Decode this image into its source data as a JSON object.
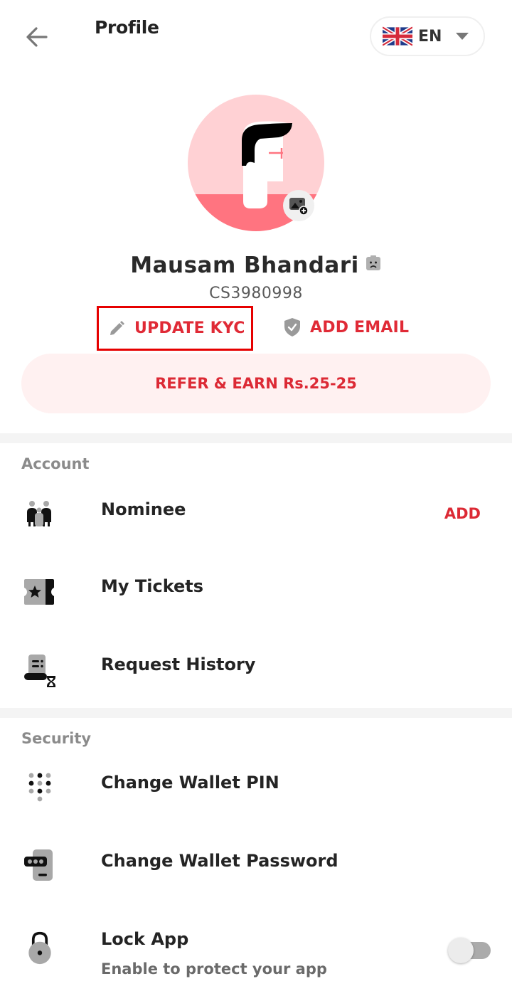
{
  "header": {
    "title": "Profile",
    "back_icon": "arrow-left-icon",
    "language": {
      "flag": "uk-flag-icon",
      "code": "EN"
    }
  },
  "profile": {
    "name": "Mausam Bhandari",
    "status_icon": "sad-face-icon",
    "user_id": "CS3980998",
    "avatar_colors": {
      "top": "#ffd1d4",
      "bottom": "#ff7480"
    }
  },
  "actions": {
    "update_kyc": "UPDATE KYC",
    "add_email": "ADD EMAIL",
    "refer": "REFER & EARN Rs.25-25"
  },
  "sections": {
    "account": {
      "label": "Account",
      "items": [
        {
          "label": "Nominee",
          "icon": "family-icon",
          "action": "ADD"
        },
        {
          "label": "My Tickets",
          "icon": "ticket-icon"
        },
        {
          "label": "Request History",
          "icon": "request-history-icon"
        }
      ]
    },
    "security": {
      "label": "Security",
      "items": [
        {
          "label": "Change Wallet PIN",
          "icon": "keypad-icon"
        },
        {
          "label": "Change Wallet Password",
          "icon": "password-icon"
        },
        {
          "label": "Lock App",
          "sublabel": "Enable to protect your app",
          "icon": "lock-icon",
          "toggle_on": false
        }
      ]
    }
  },
  "colors": {
    "accent": "#dc2a35",
    "highlight_box": "#e60000",
    "refer_bg": "#fff1f1"
  }
}
